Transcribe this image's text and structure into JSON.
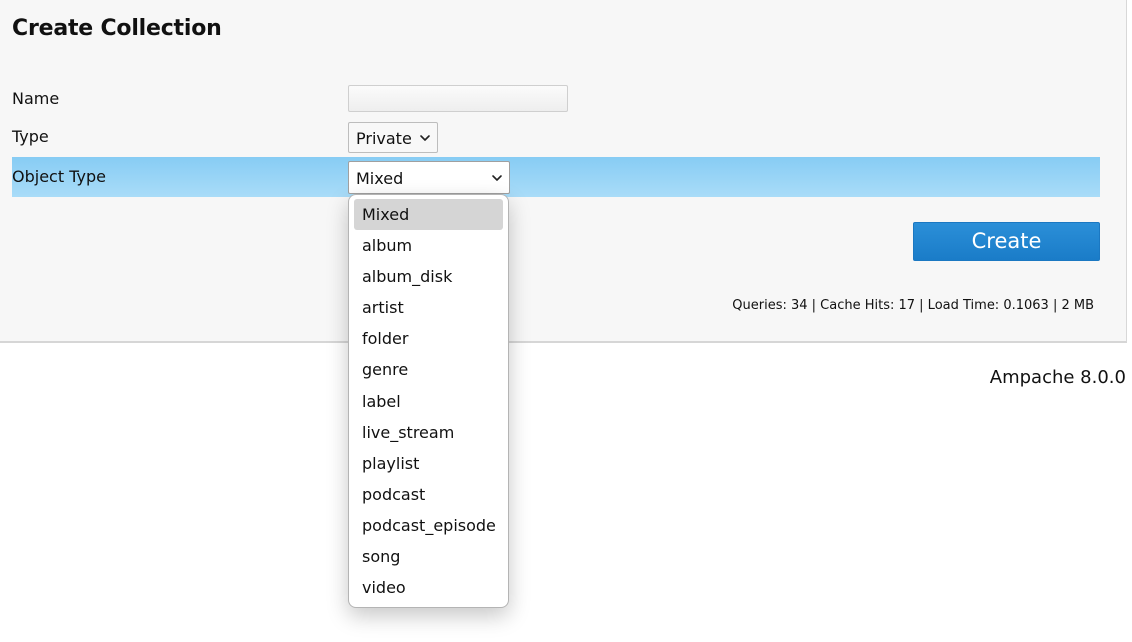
{
  "form": {
    "title": "Create Collection",
    "name_label": "Name",
    "name_value": "",
    "name_placeholder": "",
    "type_label": "Type",
    "type_value": "Private",
    "object_type_label": "Object Type",
    "object_type_value": "Mixed",
    "create_label": "Create"
  },
  "dropdown": {
    "selected_index": 0,
    "options": [
      "Mixed",
      "album",
      "album_disk",
      "artist",
      "folder",
      "genre",
      "label",
      "live_stream",
      "playlist",
      "podcast",
      "podcast_episode",
      "song",
      "video"
    ]
  },
  "footer": {
    "stats": "Queries: 34 | Cache Hits: 17 | Load Time: 0.1063 | 2 MB",
    "version": "Ampache 8.0.0"
  },
  "colors": {
    "highlight_row": "#9ad4f6",
    "button": "#1f82cd",
    "panel_bg": "#f7f7f7",
    "selected_option": "#d5d5d5"
  },
  "icons": {
    "select_arrow": "chevron-down-icon"
  }
}
